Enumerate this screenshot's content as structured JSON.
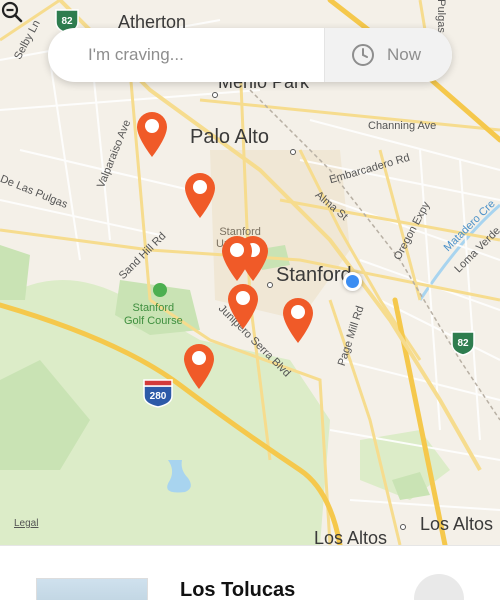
{
  "search": {
    "placeholder": "I'm craving...",
    "time_label": "Now",
    "time_icon": "clock-icon"
  },
  "map": {
    "cities": {
      "atherton": "Atherton",
      "menlo_park": "Menlo Park",
      "palo_alto": "Palo Alto",
      "stanford": "Stanford",
      "los_altos": "Los Altos",
      "los_altos_2": "Los Altos"
    },
    "streets": {
      "selby": "Selby Ln",
      "valparaiso": "Valparaiso Ave",
      "de_las_pulgas": "De Las Pulgas",
      "sand_hill": "Sand Hill Rd",
      "channing": "Channing Ave",
      "embarcadero": "Embarcadero Rd",
      "alma": "Alma St",
      "oregon": "Oregon Expy",
      "matadero": "Matadero Cre",
      "loma_verde": "Loma Verde",
      "page_mill": "Page Mill Rd",
      "junipero": "Junipero Serra Blvd",
      "pulgas": "Pulgas"
    },
    "pois": {
      "stanford_univ_1": "Stanford",
      "stanford_univ_2": "University",
      "golf_1": "Stanford",
      "golf_2": "Golf Course"
    },
    "shields": {
      "hwy82_top": "82",
      "hwy82_right": "82",
      "i280": "280"
    },
    "legal": "Legal",
    "pin_color": "#f05a28",
    "water_color": "#a8d4ef",
    "park_color": "#c9e3b4",
    "major_road_color": "#f5c84c"
  },
  "result": {
    "title": "Los Tolucas"
  }
}
